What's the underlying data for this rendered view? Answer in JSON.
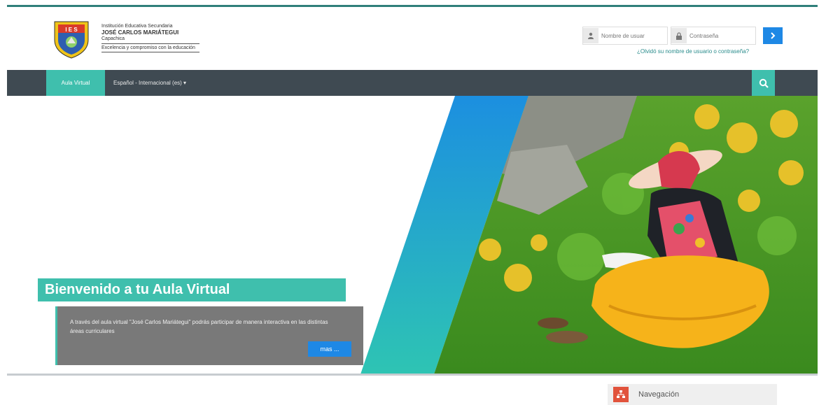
{
  "header": {
    "institution_line1": "Institución Educativa Secundaria",
    "institution_name": "JOSÉ CARLOS MARIÁTEGUI",
    "location": "Capachica",
    "tagline": "Excelencia y compromiso con la educación",
    "logo_letters": "I E S"
  },
  "login": {
    "username_placeholder": "Nombre de usuar",
    "password_placeholder": "Contraseña",
    "submit_icon": "chevron-right-icon",
    "forgot_link": "¿Olvidó su nombre de usuario o contraseña?"
  },
  "navbar": {
    "home_label": "Aula Virtual",
    "language_label": "Español - Internacional (es) ▾",
    "search_icon": "search-icon"
  },
  "hero": {
    "title": "Bienvenido a tu Aula Virtual",
    "description": "A través del aula virtual \"José Carlos Mariátegui\" podrás participar de manera interactiva en las distintas áreas curriculares",
    "more_button": "mas ..."
  },
  "blocks": {
    "navigation_title": "Navegación"
  },
  "colors": {
    "accent": "#3fbfad",
    "navbar": "#3f4a52",
    "button_blue": "#1e88e5",
    "nav_block_icon": "#e1533c"
  }
}
